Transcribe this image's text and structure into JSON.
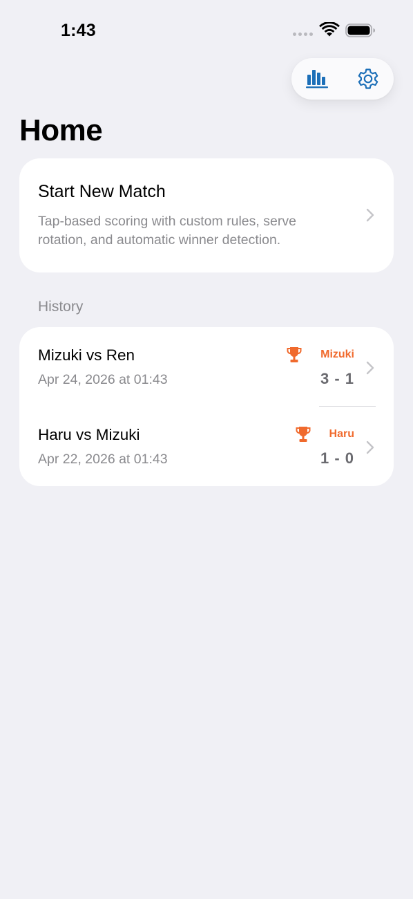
{
  "status_bar": {
    "time": "1:43"
  },
  "toolbar": {
    "stats_icon": "bar-chart-icon",
    "settings_icon": "gear-icon",
    "accent_color": "#1c6fb8"
  },
  "page": {
    "title": "Home"
  },
  "start_card": {
    "title": "Start New Match",
    "description": "Tap-based scoring with custom rules, serve rotation, and automatic winner detection."
  },
  "history": {
    "header": "History",
    "items": [
      {
        "name": "Mizuki vs Ren",
        "date": "Apr 24, 2026 at 01:43",
        "winner": "Mizuki",
        "score": "3 - 1"
      },
      {
        "name": "Haru vs Mizuki",
        "date": "Apr 22, 2026 at 01:43",
        "winner": "Haru",
        "score": "1 - 0"
      }
    ]
  },
  "colors": {
    "background": "#f0f0f5",
    "card": "#ffffff",
    "winner": "#f06a2d",
    "secondary_text": "#8a8a8e"
  }
}
